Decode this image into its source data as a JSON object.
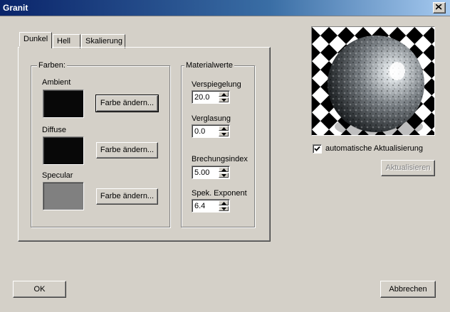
{
  "window": {
    "title": "Granit"
  },
  "tabs": [
    {
      "label": "Dunkel",
      "active": true
    },
    {
      "label": "Hell",
      "active": false
    },
    {
      "label": "Skalierung",
      "active": false
    }
  ],
  "farben": {
    "group_label": "Farben:",
    "items": [
      {
        "label": "Ambient",
        "color": "#080808",
        "button": "Farbe ändern..."
      },
      {
        "label": "Diffuse",
        "color": "#080808",
        "button": "Farbe ändern..."
      },
      {
        "label": "Specular",
        "color": "#808080",
        "button": "Farbe ändern..."
      }
    ]
  },
  "materialwerte": {
    "group_label": "Materialwerte",
    "fields": [
      {
        "label": "Verspiegelung",
        "value": "20.0"
      },
      {
        "label": "Verglasung",
        "value": "0.0"
      },
      {
        "label": "Brechungsindex",
        "value": "5.00"
      },
      {
        "label": "Spek. Exponent",
        "value": "6.4"
      }
    ]
  },
  "preview": {
    "auto_update_label": "automatische Aktualisierung",
    "auto_update_checked": true,
    "update_button": "Aktualisieren",
    "update_button_enabled": false
  },
  "footer": {
    "ok_label": "OK",
    "cancel_label": "Abbrechen"
  },
  "colors": {
    "titlebar_start": "#0a246a",
    "titlebar_end": "#a6caf0",
    "face": "#d4d0c8"
  }
}
